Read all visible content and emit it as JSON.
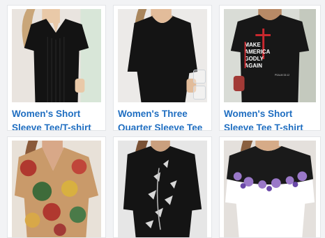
{
  "products": [
    {
      "image_desc": "black-short-sleeve-pleated-tee",
      "title_line1": "Women's Short",
      "title_line2": "Sleeve Tee/T-shirt"
    },
    {
      "image_desc": "black-scallop-neck-three-quarter-tee",
      "title_line1": "Women's Three",
      "title_line2": "Quarter Sleeve Tee"
    },
    {
      "image_desc": "black-graphic-tee",
      "title_line1": "Women's Short",
      "title_line2": "Sleeve Tee T-shirt",
      "graphic_text": {
        "line1": "MAKE",
        "line2": "AMERICA",
        "line3": "GODLY",
        "line4": "AGAIN",
        "small": "PSALM 33:12"
      }
    },
    {
      "image_desc": "floral-print-v-neck-tee"
    },
    {
      "image_desc": "black-butterfly-print-tee"
    },
    {
      "image_desc": "white-purple-floral-tee"
    }
  ],
  "colors": {
    "title": "#1f6ec1",
    "accent_red": "#c8282e"
  }
}
